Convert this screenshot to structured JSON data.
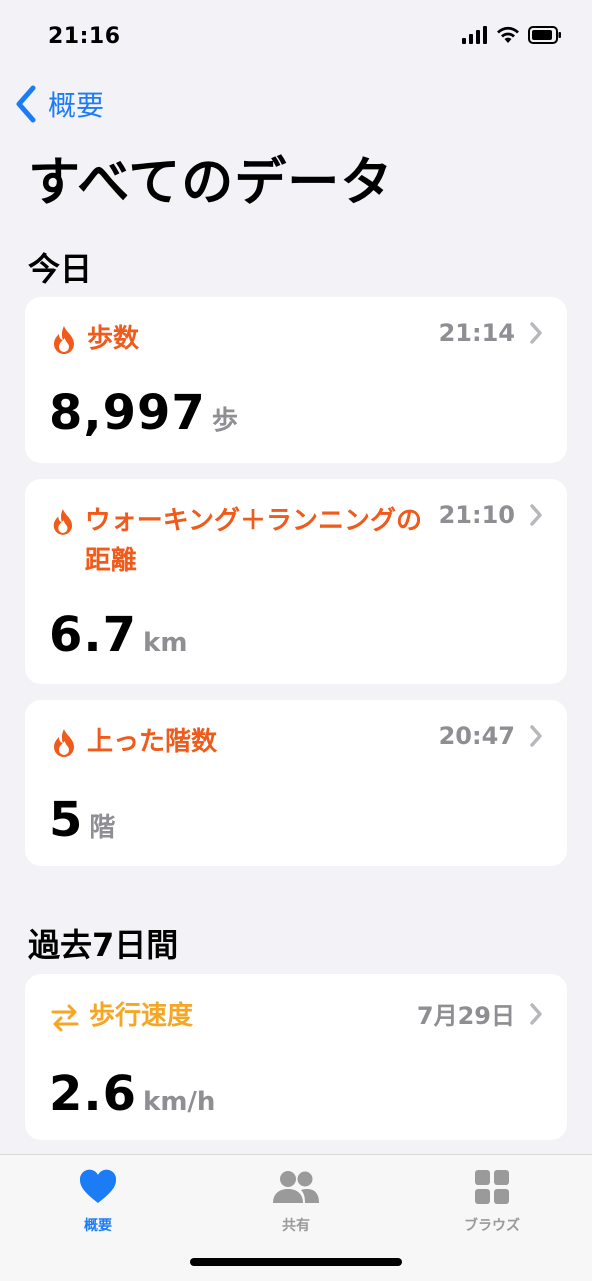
{
  "status_bar": {
    "time": "21:16"
  },
  "nav": {
    "back_label": "概要"
  },
  "page": {
    "title": "すべてのデータ"
  },
  "sections": {
    "today": "今日",
    "past7": "過去7日間"
  },
  "cards": [
    {
      "category": "歩数",
      "time": "21:14",
      "value": "8,997",
      "unit": "歩",
      "icon": "flame-icon",
      "color": "#f05a1a"
    },
    {
      "category": "ウォーキング＋ランニングの距離",
      "time": "21:10",
      "value": "6.7",
      "unit": "km",
      "icon": "flame-icon",
      "color": "#f05a1a"
    },
    {
      "category": "上った階数",
      "time": "20:47",
      "value": "5",
      "unit": "階",
      "icon": "flame-icon",
      "color": "#f05a1a"
    },
    {
      "category": "歩行速度",
      "time": "7月29日",
      "value": "2.6",
      "unit": "km/h",
      "icon": "arrows-icon",
      "color": "#f5a623"
    }
  ],
  "tabbar": {
    "tabs": [
      {
        "label": "概要",
        "icon": "heart-icon",
        "active": true
      },
      {
        "label": "共有",
        "icon": "people-icon",
        "active": false
      },
      {
        "label": "ブラウズ",
        "icon": "grid-icon",
        "active": false
      }
    ]
  }
}
